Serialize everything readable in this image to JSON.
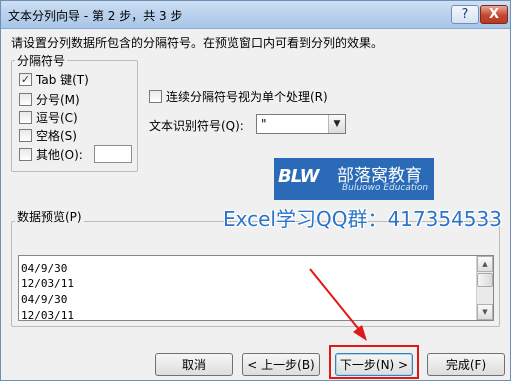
{
  "title": "文本分列向导 - 第 2 步，共 3 步",
  "title_buttons": {
    "help": "?",
    "close": "X"
  },
  "description": "请设置分列数据所包含的分隔符号。在预览窗口内可看到分列的效果。",
  "delimiters": {
    "group_label": "分隔符号",
    "items": [
      {
        "label": "Tab 键(T)",
        "checked": true
      },
      {
        "label": "分号(M)",
        "checked": false
      },
      {
        "label": "逗号(C)",
        "checked": false
      },
      {
        "label": "空格(S)",
        "checked": false
      },
      {
        "label": "其他(O):",
        "checked": false
      }
    ],
    "other_value": ""
  },
  "consecutive": {
    "label": "连续分隔符号视为单个处理(R)",
    "checked": false
  },
  "text_qualifier": {
    "label": "文本识别符号(Q):",
    "value": "\""
  },
  "logo": {
    "cn": "部落窝教育",
    "en": "Buluowo Education",
    "mark": "BLW"
  },
  "watermark": "Excel学习QQ群：417354533",
  "preview": {
    "label": "数据预览(P)",
    "lines": [
      "04/9/30",
      "12/03/11",
      "04/9/30",
      "12/03/11"
    ]
  },
  "buttons": {
    "cancel": "取消",
    "back": "< 上一步(B)",
    "next": "下一步(N) >",
    "finish": "完成(F)"
  },
  "colors": {
    "highlight": "#e01818",
    "arrow": "#e01818",
    "logo_bg": "#2a6ab7",
    "watermark": "#2b74c9"
  }
}
